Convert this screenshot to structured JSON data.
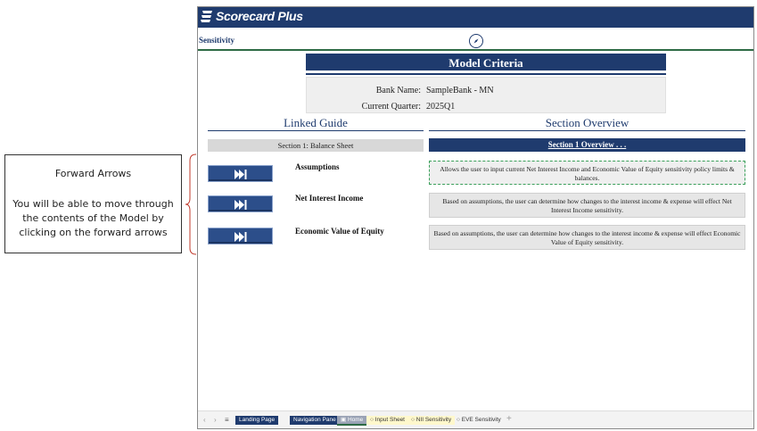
{
  "app": {
    "title": "Scorecard Plus",
    "subheader": "Sensitivity"
  },
  "callout": {
    "title": "Forward Arrows",
    "description": "You will be able to move through the contents of the Model by clicking on the forward arrows"
  },
  "model_criteria": {
    "header": "Model Criteria",
    "bank_name_label": "Bank Name:",
    "bank_name_value": "SampleBank - MN",
    "quarter_label": "Current Quarter:",
    "quarter_value": "2025Q1"
  },
  "linked_guide": {
    "title": "Linked Guide",
    "section_label": "Section 1: Balance Sheet"
  },
  "section_overview": {
    "title": "Section Overview",
    "section_label": "Section 1 Overview . . ."
  },
  "rows": [
    {
      "label": "Assumptions",
      "description": "Allows the user to input current Net Interest Income and Economic Value of Equity sensitivity policy limits & balances."
    },
    {
      "label": "Net Interest Income",
      "description": "Based on assumptions, the user can determine how changes to the interest income & expense will effect Net Interest Income sensitivity."
    },
    {
      "label": "Economic Value of Equity",
      "description": "Based on assumptions, the user can determine how changes to the interest income & expense will effect Economic Value of Equity sensitivity."
    }
  ],
  "tabs": {
    "landing": "Landing Page",
    "navigation": "Navigation Pane",
    "home": "Home",
    "input": "Input Sheet",
    "nii": "NII Sensitivity",
    "eve": "EVE Sensitivity"
  },
  "colors": {
    "brand_navy": "#1f3b6e",
    "accent_green": "#2e6b45",
    "button_blue": "#2c4e8a"
  }
}
